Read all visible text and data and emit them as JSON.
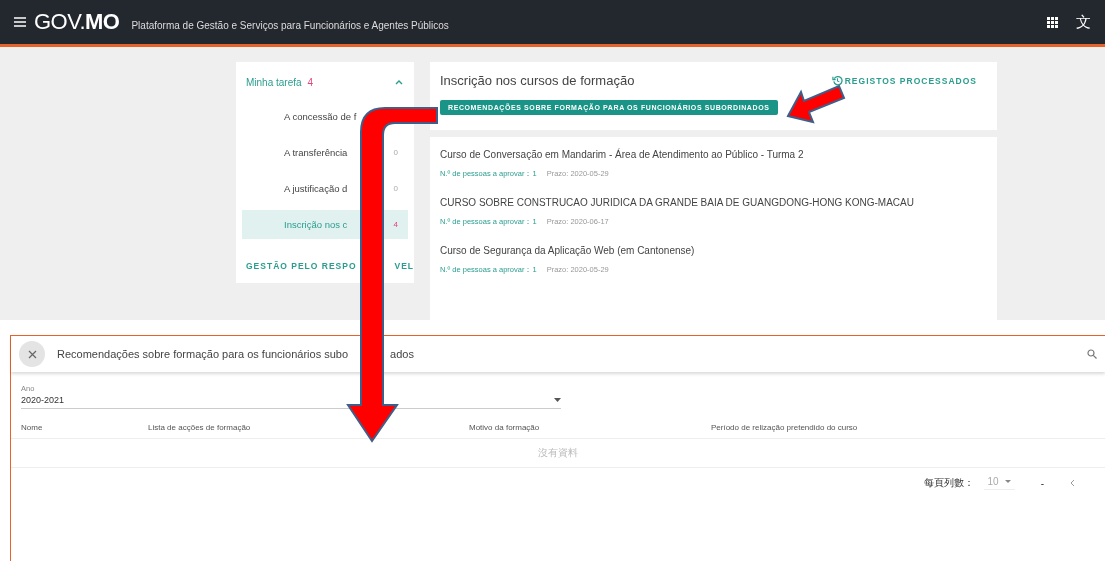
{
  "header": {
    "logo": "GOV.**MO**",
    "subtitle": "Plataforma de Gestão e Serviços para Funcionários e Agentes Públicos",
    "language": "文"
  },
  "sidebar": {
    "title": "Minha tarefa",
    "count": "4",
    "expanded": true,
    "items": [
      {
        "label": "A concessão de f",
        "selected": false
      },
      {
        "label": "A transferência",
        "count": "0",
        "selected": false
      },
      {
        "label": "A justificação d",
        "count": "0",
        "selected": false
      },
      {
        "label": "Inscrição nos c",
        "count": "4",
        "selected": true
      }
    ],
    "footer_link": [
      "GESTÃO PELO RESPO",
      "VEL"
    ]
  },
  "main": {
    "title": "Inscrição nos cursos de formação",
    "history_link": "REGISTOS PROCESSADOS",
    "action_button": "RECOMENDAÇÕES SOBRE FORMAÇÃO PARA OS FUNCIONÁRIOS SUBORDINADOS",
    "courses": [
      {
        "name": "Curso de Conversação em Mandarim - Área de Atendimento ao Público - Turma 2",
        "approve_label": "N.º de pessoas a aprovar：1",
        "deadline": "Prazo: 2020-05-29"
      },
      {
        "name": "CURSO SOBRE CONSTRUCAO JURIDICA DA GRANDE BAIA DE GUANGDONG-HONG KONG-MACAU",
        "approve_label": "N.º de pessoas a aprovar：1",
        "deadline": "Prazo: 2020-06-17"
      },
      {
        "name": "Curso de Segurança da Aplicação Web (em Cantonense)",
        "approve_label": "N.º de pessoas a aprovar：1",
        "deadline": "Prazo: 2020-05-29"
      }
    ]
  },
  "dialog": {
    "title": [
      "Recomendações sobre formação para os funcionários subo",
      "ados"
    ],
    "year_field": {
      "label": "Ano",
      "value": "2020-2021"
    },
    "table": {
      "columns": [
        "Nome",
        "Lista de acções de formação",
        "Motivo da formação",
        "Período de relização pretendido do curso"
      ],
      "empty_text": "沒有資料"
    },
    "pagination": {
      "rows_label": "每頁列數：",
      "rows_value": "10",
      "range": "-"
    }
  }
}
